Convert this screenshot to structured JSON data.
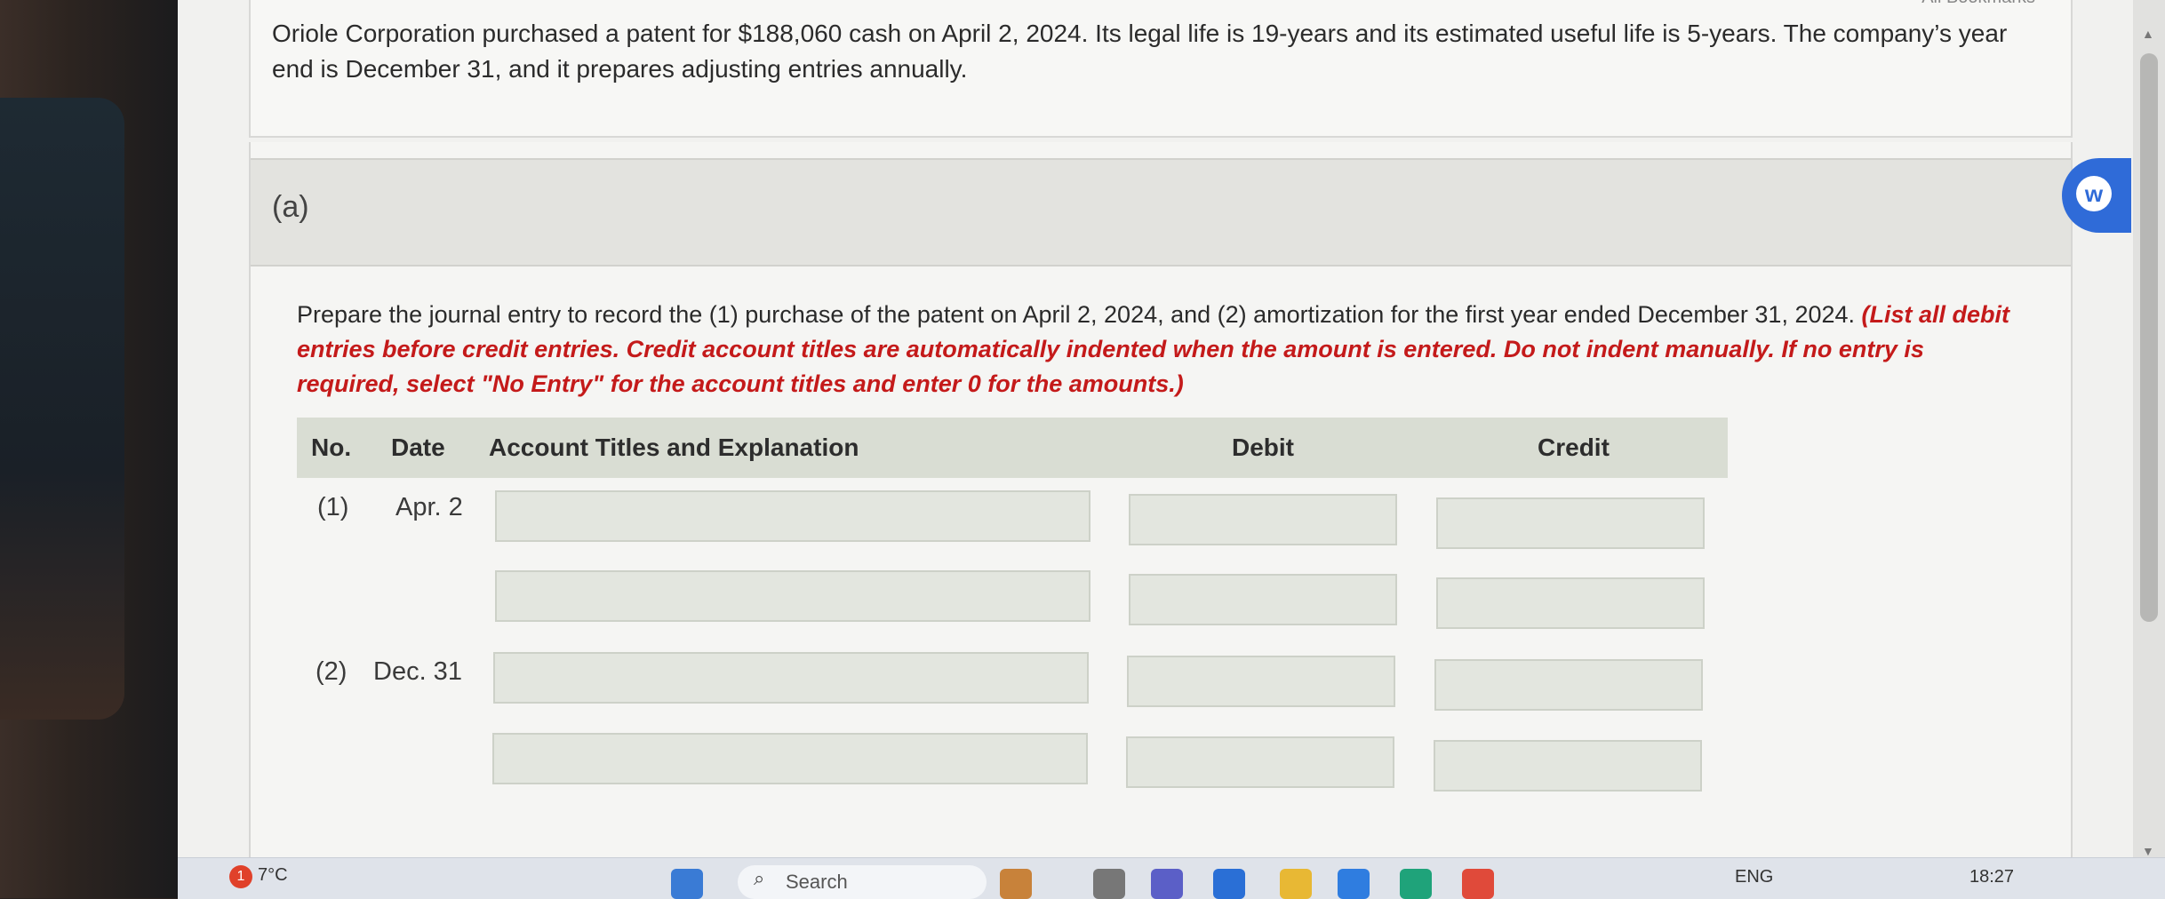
{
  "top_right_label": "All Bookmarks",
  "intro": {
    "text": "Oriole Corporation purchased a patent for $188,060 cash on April 2, 2024. Its legal life is 19-years and its estimated useful life is 5-years. The company’s year end is December 31, and it prepares adjusting entries annually."
  },
  "part": {
    "label": "(a)",
    "instruction_plain": "Prepare the journal entry to record the (1) purchase of the patent on April 2, 2024, and (2) amortization for the first year ended December 31, 2024.",
    "instruction_emphasis": "(List all debit entries before credit entries. Credit account titles are automatically indented when the amount is entered. Do not indent manually. If no entry is required, select \"No Entry\" for the account titles and enter 0 for the amounts.)"
  },
  "journal": {
    "headers": {
      "no": "No.",
      "date": "Date",
      "account": "Account Titles and Explanation",
      "debit": "Debit",
      "credit": "Credit"
    },
    "entries": [
      {
        "no": "(1)",
        "date": "Apr. 2"
      },
      {
        "no": "(2)",
        "date": "Dec. 31"
      }
    ]
  },
  "fab": {
    "icon": "wiley-assistant-icon",
    "glyph": "w",
    "color": "#2f6bd8"
  },
  "taskbar": {
    "notification_count": "1",
    "temperature": "7°C",
    "search_placeholder": "Search",
    "language": "ENG",
    "time": "18:27"
  },
  "colors": {
    "emphasis": "#c41a1a",
    "table_header_bg": "#d9ddd3",
    "input_bg": "#e3e6df"
  }
}
